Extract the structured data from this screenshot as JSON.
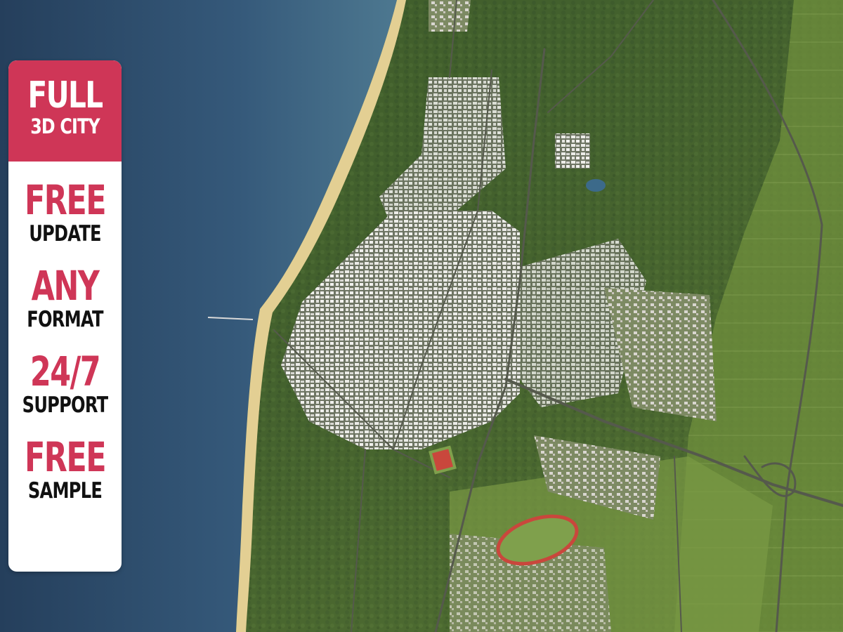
{
  "badge": {
    "header": {
      "big": "FULL",
      "small": "3D CITY"
    },
    "features": [
      {
        "big": "FREE",
        "small": "UPDATE"
      },
      {
        "big": "ANY",
        "small": "FORMAT"
      },
      {
        "big": "24/7",
        "small": "SUPPORT"
      },
      {
        "big": "FREE",
        "small": "SAMPLE"
      }
    ]
  },
  "colors": {
    "accent": "#cf3657",
    "sea": "#2f5375",
    "forest": "#3f5f2c",
    "field": "#6f8f3c",
    "beach": "#e3cf93",
    "building": "#e9e9e6",
    "track": "#c9473c"
  }
}
